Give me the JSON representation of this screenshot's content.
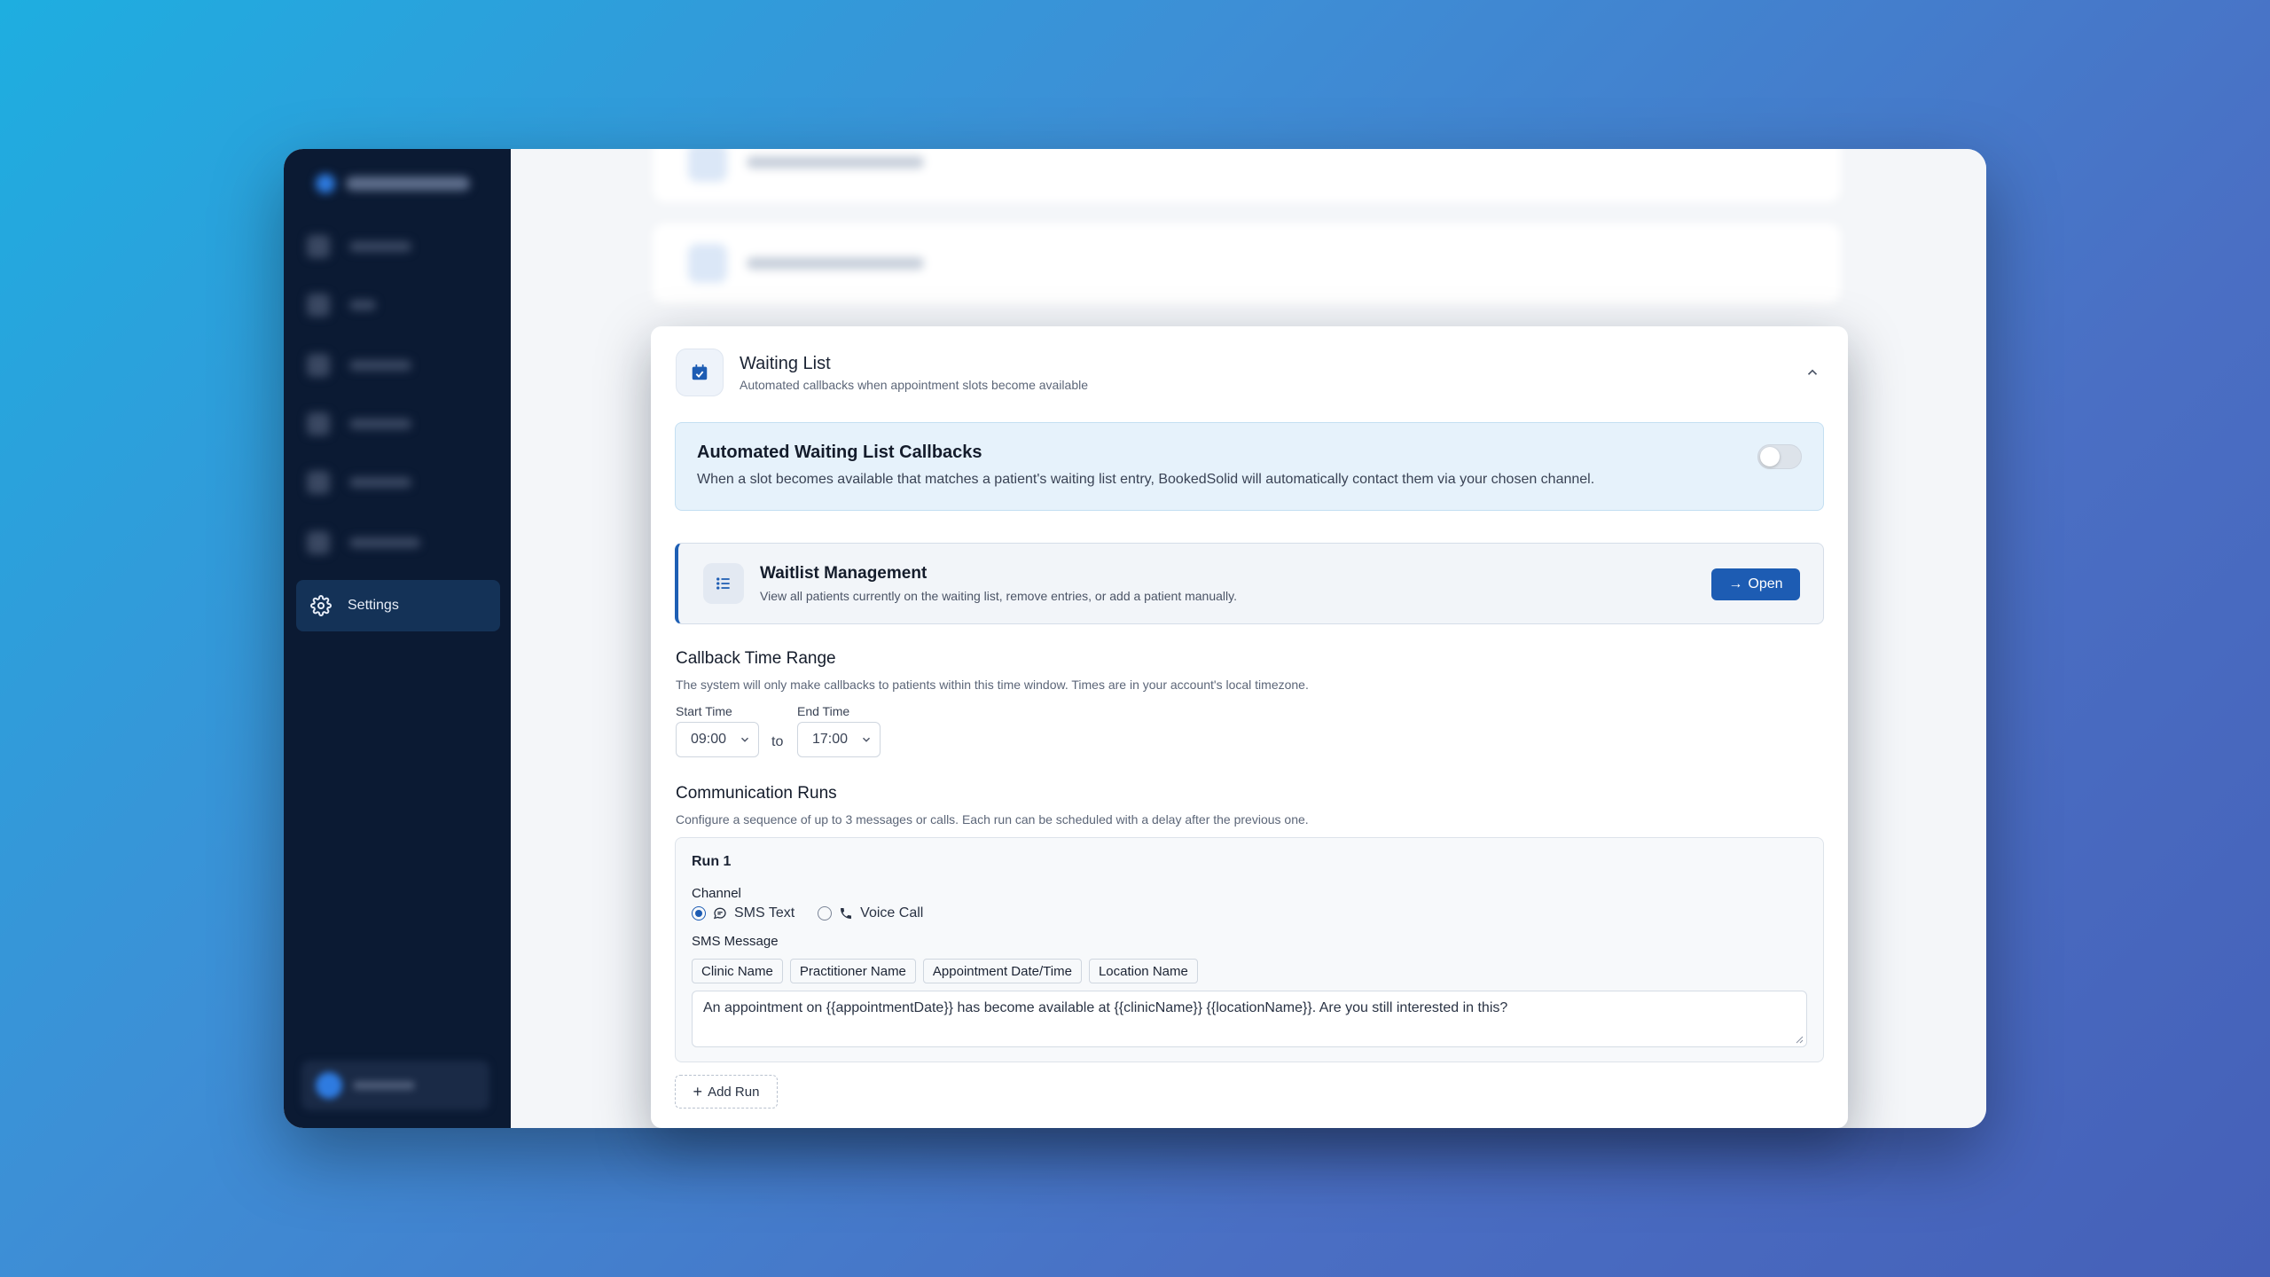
{
  "background_app": {
    "sidebar_active_label": "Settings"
  },
  "modal": {
    "header": {
      "title": "Waiting List",
      "subtitle": "Automated callbacks when appointment slots become available",
      "icon": "calendar-check-icon"
    },
    "auto_callbacks": {
      "title": "Automated Waiting List Callbacks",
      "description": "When a slot becomes available that matches a patient's waiting list entry, BookedSolid will automatically contact them via your chosen channel.",
      "enabled": false
    },
    "waitlist_management": {
      "title": "Waitlist Management",
      "description": "View all patients currently on the waiting list, remove entries, or add a patient manually.",
      "button_label": "Open",
      "button_icon": "arrow-right-icon"
    },
    "callback_time_range": {
      "title": "Callback Time Range",
      "description": "The system will only make callbacks to patients within this time window. Times are in your account's local timezone.",
      "start_label": "Start Time",
      "start_value": "09:00",
      "to_text": "to",
      "end_label": "End Time",
      "end_value": "17:00"
    },
    "communication_runs": {
      "title": "Communication Runs",
      "description": "Configure a sequence of up to 3 messages or calls. Each run can be scheduled with a delay after the previous one.",
      "runs": [
        {
          "title": "Run 1",
          "channel_label": "Channel",
          "channels": [
            {
              "label": "SMS Text",
              "icon": "chat-bubble-icon",
              "selected": true
            },
            {
              "label": "Voice Call",
              "icon": "phone-icon",
              "selected": false
            }
          ],
          "message_label": "SMS Message",
          "placeholders": [
            "Clinic Name",
            "Practitioner Name",
            "Appointment Date/Time",
            "Location Name"
          ],
          "message": "An appointment on {{appointmentDate}} has become available at {{clinicName}} {{locationName}}. Are you still interested in this?"
        }
      ],
      "add_run_label": "Add Run"
    }
  },
  "colors": {
    "primary": "#1d5cb3",
    "sidebar": "#0b1a33",
    "info_bg": "#e6f2fb"
  }
}
